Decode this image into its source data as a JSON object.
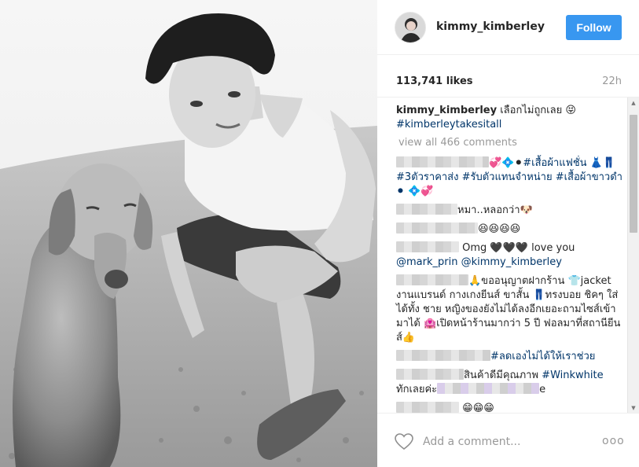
{
  "post": {
    "username": "kimmy_kimberley",
    "follow_label": "Follow",
    "likes": "113,741 likes",
    "time": "22h",
    "caption_user": "kimmy_kimberley",
    "caption_text": " เลือกไม่ถูกเลย 😝",
    "caption_tag": "#kimberleytakesitall",
    "view_all": "view all 466 comments"
  },
  "comments": [
    {
      "pre": "💞💠⚫",
      "text": "#เสื้อผ้าแฟชั่น 👗👖 #3ตัวราคาส่ง #รับตัวแทนจำหน่าย #เสื้อผ้าขาวดำ ⚫ 💠💞"
    },
    {
      "text": "หมา..หลอกว่า🐶"
    },
    {
      "text": "😆😆😆😆"
    },
    {
      "text": "Omg 🖤🖤🖤 love you",
      "mention1": "@mark_prin",
      "mention2": "@kimmy_kimberley"
    },
    {
      "text": "🙏ขออนุญาตฝากร้าน 👕jacket งานแบรนด์ กางเกงยีนส์ ขาสั้น 👖ทรงบอย ชิคๆ ใส่ได้ทั้ง ชาย หญิงของยังไม่ได้ลงอีกเยอะถามไซส์เข้ามาได้ 🏩เปิดหน้าร้านมากว่า 5 ปี ฟอลมาที่สถานียีนส์👍"
    },
    {
      "tag": "#ลดเองไม่ได้ให้เราช่วย"
    },
    {
      "text": "สินค้าดีมีคุณภาพ",
      "tag": "#Winkwhite",
      "text2": "ทักเลยค่ะ",
      "tail": "e"
    },
    {
      "text": "😁😁😁"
    }
  ],
  "footer": {
    "placeholder": "Add a comment...",
    "more": "ooo"
  },
  "icons": {
    "heart": "heart-icon",
    "more": "more-options-icon",
    "scroll_up": "scroll-up-icon",
    "scroll_down": "scroll-down-icon"
  },
  "colors": {
    "follow_bg": "#3897f0",
    "link": "#003569",
    "muted": "#999999"
  }
}
